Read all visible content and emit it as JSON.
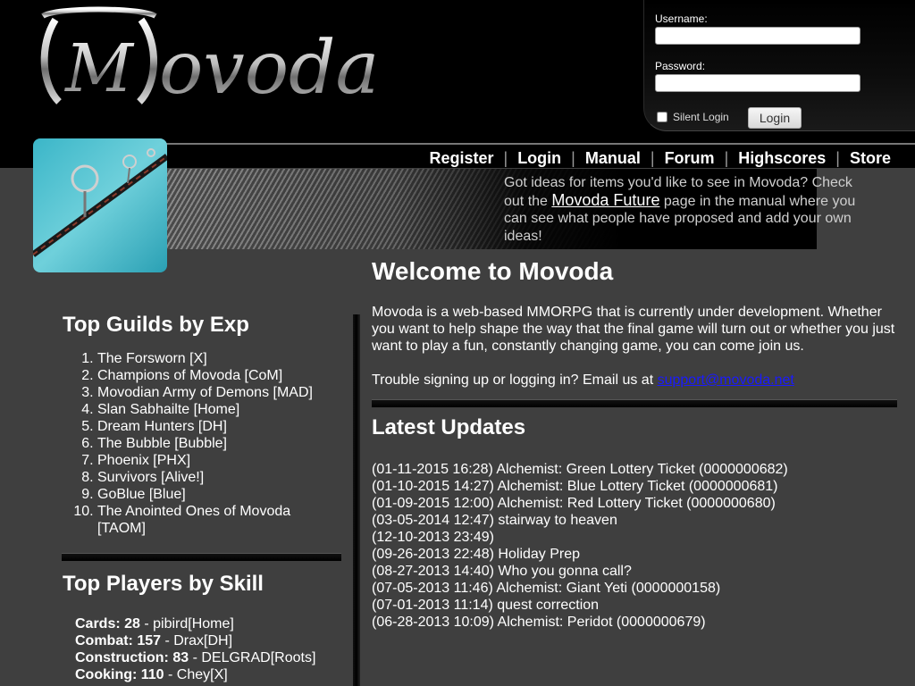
{
  "header": {
    "logo_text": "Movoda",
    "login": {
      "username_label": "Username:",
      "password_label": "Password:",
      "username_value": "",
      "password_value": "",
      "silent_login_label": "Silent Login",
      "login_button": "Login"
    }
  },
  "nav": {
    "items": [
      "Register",
      "Login",
      "Manual",
      "Forum",
      "Highscores",
      "Store"
    ]
  },
  "banner": {
    "text_before": "Got ideas for items you'd like to see in Movoda? Check out the",
    "link_text": "Movoda Future",
    "text_after": "page in the manual where you can see what people have proposed and add your own ideas!"
  },
  "guilds": {
    "title": "Top Guilds by Exp",
    "items": [
      "The Forsworn [X]",
      "Champions of Movoda [CoM]",
      "Movodian Army of Demons [MAD]",
      "Slan Sabhailte [Home]",
      "Dream Hunters [DH]",
      "The Bubble [Bubble]",
      "Phoenix [PHX]",
      "Survivors [Alive!]",
      "GoBlue [Blue]",
      "The Anointed Ones of Movoda [TAOM]"
    ]
  },
  "players": {
    "title": "Top Players by Skill",
    "items": [
      {
        "skill": "Cards: 28",
        "player": "pibird[Home]"
      },
      {
        "skill": "Combat: 157",
        "player": "Drax[DH]"
      },
      {
        "skill": "Construction: 83",
        "player": "DELGRAD[Roots]"
      },
      {
        "skill": "Cooking: 110",
        "player": "Chey[X]"
      }
    ]
  },
  "welcome": {
    "title": "Welcome to Movoda",
    "intro": "Movoda is a web-based MMORPG that is currently under development. Whether you want to help shape the way that the final game will turn out or whether you just want to play a fun, constantly changing game, you can come join us.",
    "trouble_text": "Trouble signing up or logging in? Email us at",
    "email": "support@movoda.net"
  },
  "updates": {
    "title": "Latest Updates",
    "items": [
      "(01-11-2015 16:28) Alchemist: Green Lottery Ticket (0000000682)",
      "(01-10-2015 14:27) Alchemist: Blue Lottery Ticket (0000000681)",
      "(01-09-2015 12:00) Alchemist: Red Lottery Ticket (0000000680)",
      "(03-05-2014 12:47) stairway to heaven",
      "(12-10-2013 23:49)",
      "(09-26-2013 22:48) Holiday Prep",
      "(08-27-2013 14:40) Who you gonna call?",
      "(07-05-2013 11:46) Alchemist: Giant Yeti (0000000158)",
      "(07-01-2013 11:14) quest correction",
      "(06-28-2013 10:09) Alchemist: Peridot (0000000679)"
    ]
  }
}
